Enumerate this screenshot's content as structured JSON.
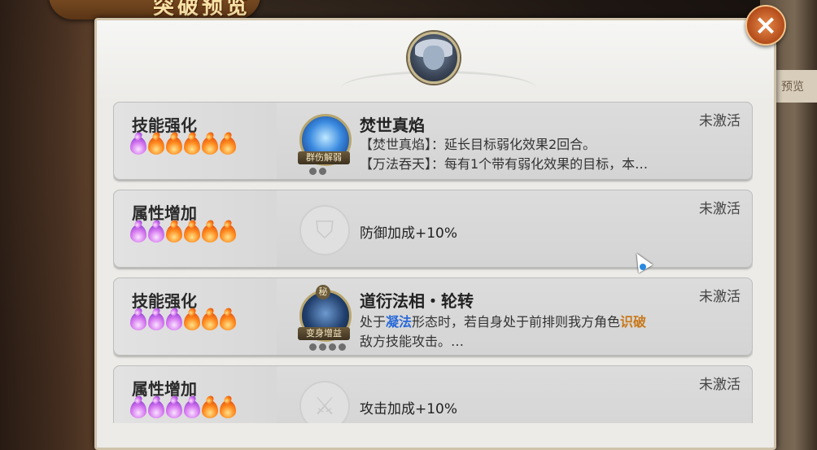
{
  "title": "突破预览",
  "side_label": "预览",
  "close_label": "×",
  "rows": [
    {
      "type": "技能强化",
      "flames": [
        "purple",
        "on",
        "on",
        "on",
        "on",
        "on"
      ],
      "status": "未激活",
      "kind": "skill",
      "icon_color": "blue",
      "icon_badge": "群伤解弱",
      "name": "焚世真焰",
      "lines": [
        "【焚世真焰】：延长目标弱化效果2回合。",
        "【万法吞天】：每有1个带有弱化效果的目标，本…"
      ]
    },
    {
      "type": "属性增加",
      "flames": [
        "purple",
        "purple",
        "on",
        "on",
        "on",
        "on"
      ],
      "status": "未激活",
      "kind": "attr",
      "icon": "shield-icon",
      "text": "防御加成+10%"
    },
    {
      "type": "技能强化",
      "flames": [
        "purple",
        "purple",
        "purple",
        "on",
        "on",
        "on"
      ],
      "status": "未激活",
      "kind": "skill",
      "icon_color": "dark",
      "icon_badge": "变身增益",
      "icon_top_badge": "秘",
      "name": "道衍法相・轮转",
      "line1_pre": "处于",
      "line1_kw1": "凝法",
      "line1_mid": "形态时，若自身处于前排则我方角色",
      "line1_kw2": "识破",
      "line2": "敌方技能攻击。…"
    },
    {
      "type": "属性增加",
      "flames": [
        "purple",
        "purple",
        "purple",
        "purple",
        "on",
        "on"
      ],
      "status": "未激活",
      "kind": "attr",
      "icon": "sword-icon",
      "text": "攻击加成+10%"
    }
  ],
  "colors": {
    "accent_blue": "#2a6ad8",
    "accent_orange": "#c8781a",
    "panel": "#ecebe8"
  }
}
